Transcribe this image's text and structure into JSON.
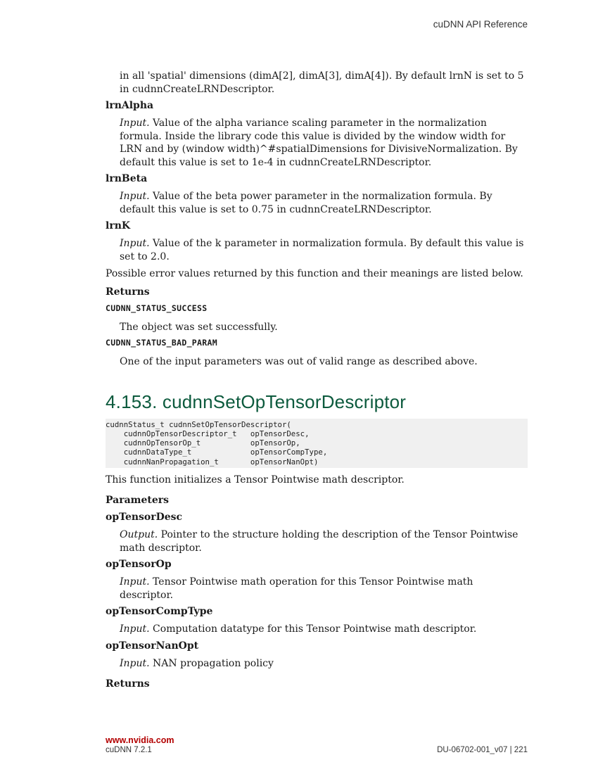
{
  "header": {
    "title": "cuDNN API Reference"
  },
  "top": {
    "lrnN_continuation": "in all 'spatial' dimensions (dimA[2], dimA[3], dimA[4]). By default lrnN is set to 5 in cudnnCreateLRNDescriptor.",
    "params": [
      {
        "name": "lrnAlpha",
        "kind": "Input.",
        "desc": " Value of the alpha variance scaling parameter in the normalization formula. Inside the library code this value is divided by the window width for LRN and by (window width)^#spatialDimensions for DivisiveNormalization. By default this value is set to 1e-4 in cudnnCreateLRNDescriptor."
      },
      {
        "name": "lrnBeta",
        "kind": "Input.",
        "desc": " Value of the beta power parameter in the normalization formula. By default this value is set to 0.75 in cudnnCreateLRNDescriptor."
      },
      {
        "name": "lrnK",
        "kind": "Input.",
        "desc": " Value of the k parameter in normalization formula. By default this value is set to 2.0."
      }
    ],
    "error_intro": "Possible error values returned by this function and their meanings are listed below.",
    "returns_label": "Returns",
    "returns": [
      {
        "code": "CUDNN_STATUS_SUCCESS",
        "desc": "The object was set successfully."
      },
      {
        "code": "CUDNN_STATUS_BAD_PARAM",
        "desc": "One of the input parameters was out of valid range as described above."
      }
    ]
  },
  "section": {
    "heading": "4.153. cudnnSetOpTensorDescriptor",
    "code": "cudnnStatus_t cudnnSetOpTensorDescriptor(\n    cudnnOpTensorDescriptor_t   opTensorDesc,\n    cudnnOpTensorOp_t           opTensorOp,\n    cudnnDataType_t             opTensorCompType,\n    cudnnNanPropagation_t       opTensorNanOpt)",
    "intro": "This function initializes a Tensor Pointwise math descriptor.",
    "params_label": "Parameters",
    "params": [
      {
        "name": "opTensorDesc",
        "kind": "Output.",
        "desc": " Pointer to the structure holding the description of the Tensor Pointwise math descriptor."
      },
      {
        "name": "opTensorOp",
        "kind": "Input.",
        "desc": " Tensor Pointwise math operation for this Tensor Pointwise math descriptor."
      },
      {
        "name": "opTensorCompType",
        "kind": "Input.",
        "desc": " Computation datatype for this Tensor Pointwise math descriptor."
      },
      {
        "name": "opTensorNanOpt",
        "kind": "Input.",
        "desc": " NAN propagation policy"
      }
    ],
    "returns_label": "Returns"
  },
  "footer": {
    "url": "www.nvidia.com",
    "version": "cuDNN 7.2.1",
    "doc_page": "DU-06702-001_v07  |  221"
  }
}
